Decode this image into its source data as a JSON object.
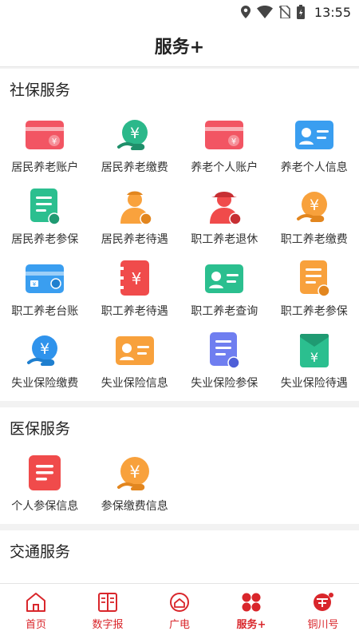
{
  "status_bar": {
    "time": "13:55"
  },
  "header": {
    "title": "服务+"
  },
  "sections": [
    {
      "title": "社保服务",
      "items": [
        {
          "label": "居民养老账户",
          "icon": "card-icon"
        },
        {
          "label": "居民养老缴费",
          "icon": "yen-hand-icon"
        },
        {
          "label": "养老个人账户",
          "icon": "card-icon"
        },
        {
          "label": "养老个人信息",
          "icon": "id-card-icon"
        },
        {
          "label": "居民养老参保",
          "icon": "document-icon"
        },
        {
          "label": "居民养老待遇",
          "icon": "elder-person-icon"
        },
        {
          "label": "职工养老退休",
          "icon": "retired-person-icon"
        },
        {
          "label": "职工养老缴费",
          "icon": "yen-hand-icon"
        },
        {
          "label": "职工养老台账",
          "icon": "ledger-card-icon"
        },
        {
          "label": "职工养老待遇",
          "icon": "yen-book-icon"
        },
        {
          "label": "职工养老查询",
          "icon": "id-card-icon"
        },
        {
          "label": "职工养老参保",
          "icon": "document-icon"
        },
        {
          "label": "失业保险缴费",
          "icon": "yen-hand-icon"
        },
        {
          "label": "失业保险信息",
          "icon": "id-card-icon"
        },
        {
          "label": "失业保险参保",
          "icon": "document-icon"
        },
        {
          "label": "失业保险待遇",
          "icon": "yen-envelope-icon"
        }
      ]
    },
    {
      "title": "医保服务",
      "items": [
        {
          "label": "个人参保信息",
          "icon": "list-document-icon"
        },
        {
          "label": "参保缴费信息",
          "icon": "yen-hand-icon"
        }
      ]
    },
    {
      "title": "交通服务",
      "items": []
    }
  ],
  "tabs": [
    {
      "label": "首页",
      "icon": "home-icon"
    },
    {
      "label": "数字报",
      "icon": "newspaper-icon"
    },
    {
      "label": "广电",
      "icon": "broadcast-icon"
    },
    {
      "label": "服务+",
      "icon": "services-grid-icon",
      "active": true
    },
    {
      "label": "铜川号",
      "icon": "tongchuan-icon"
    }
  ],
  "colors": {
    "accent": "#d9262b",
    "background": "#f2f2f2"
  }
}
